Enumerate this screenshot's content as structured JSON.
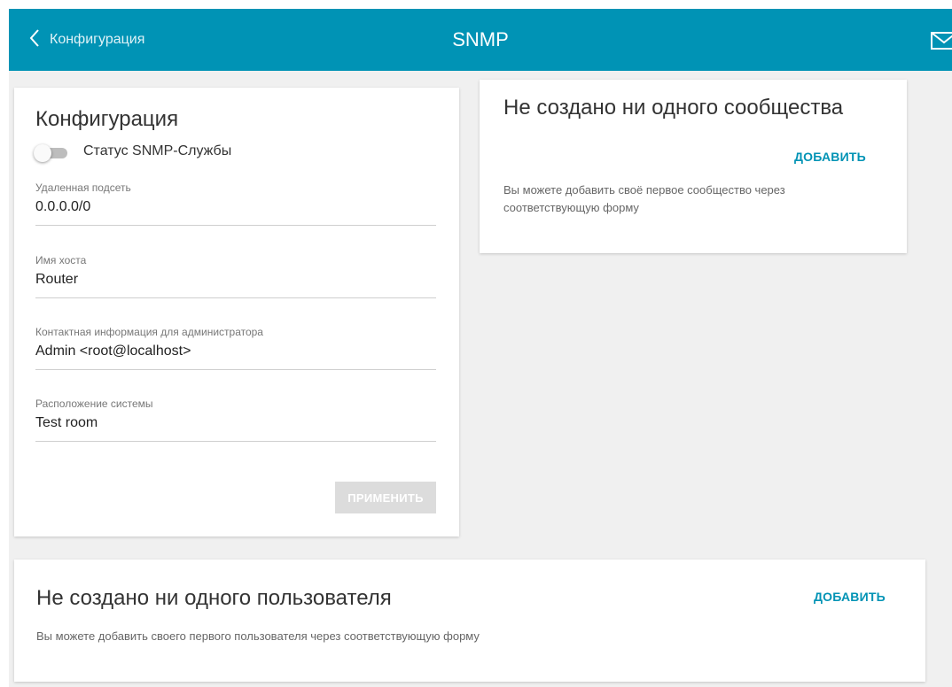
{
  "header": {
    "back_label": "Конфигурация",
    "title": "SNMP",
    "back_icon": "chevron-left-icon",
    "mail_icon": "mail-icon",
    "color": "#0093b5"
  },
  "config": {
    "title": "Конфигурация",
    "toggle": {
      "label": "Статус SNMP-Службы",
      "enabled": false
    },
    "fields": [
      {
        "label": "Удаленная подсеть",
        "value": "0.0.0.0/0"
      },
      {
        "label": "Имя хоста",
        "value": "Router"
      },
      {
        "label": "Контактная информация для администратора",
        "value": "Admin <root@localhost>"
      },
      {
        "label": "Расположение системы",
        "value": "Test room"
      }
    ],
    "apply_label": "ПРИМЕНИТЬ"
  },
  "communities": {
    "title": "Не создано ни одного сообщества",
    "add_label": "ДОБАВИТЬ",
    "description": "Вы можете добавить своё первое сообщество через соответствующую форму"
  },
  "users": {
    "title": "Не создано ни одного пользователя",
    "add_label": "ДОБАВИТЬ",
    "description": "Вы можете добавить своего первого пользователя через соответствующую форму"
  }
}
